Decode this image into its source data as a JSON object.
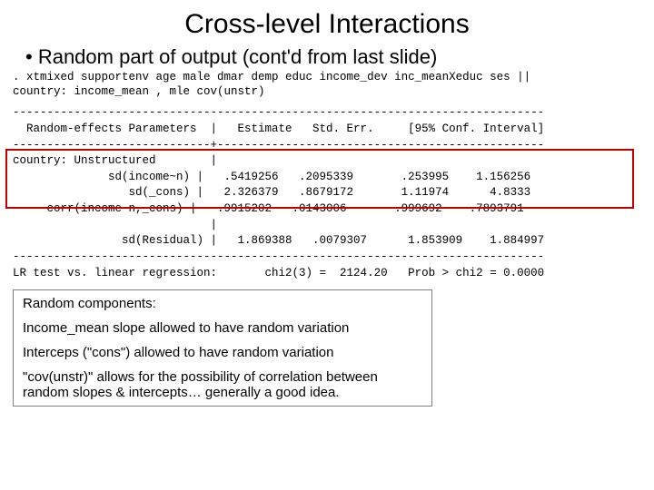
{
  "title": "Cross-level Interactions",
  "bullet": "Random part of output (cont'd from last slide)",
  "cmd": ". xtmixed supportenv age male dmar demp educ income_dev inc_meanXeduc ses ||\ncountry: income_mean , mle cov(unstr)",
  "table": {
    "hrule": "------------------------------------------------------------------------------",
    "hrule2": "-----------------------------+------------------------------------------------",
    "header": "  Random-effects Parameters  |   Estimate   Std. Err.     [95% Conf. Interval]",
    "rows": {
      "r0": "country: Unstructured        |",
      "r1": "              sd(income~n) |   .5419256   .2095339       .253995    1.156256",
      "r2": "                 sd(_cons) |   2.326379   .8679172       1.11974      4.8333",
      "r3": "     corr(income~n,_cons) |  -.9915202   .0143006      -.999692   -.7893791",
      "r4": "                             |",
      "r5": "                sd(Residual) |   1.869388   .0079307      1.853909    1.884997"
    },
    "lr": "LR test vs. linear regression:       chi2(3) =  2124.20   Prob > chi2 = 0.0000"
  },
  "box": {
    "heading": "Random components:",
    "p1": "Income_mean slope allowed to have random variation",
    "p2": "Interceps (\"cons\") allowed to have random variation",
    "p3": "\"cov(unstr)\" allows for the possibility of correlation between random slopes & intercepts… generally a good idea."
  },
  "chart_data": {
    "type": "table",
    "title": "Random-effects Parameters",
    "columns": [
      "Parameter",
      "Estimate",
      "Std. Err.",
      "95% CI Low",
      "95% CI High"
    ],
    "rows": [
      {
        "Parameter": "sd(income~n)",
        "Estimate": 0.5419256,
        "Std. Err.": 0.2095339,
        "95% CI Low": 0.253995,
        "95% CI High": 1.156256
      },
      {
        "Parameter": "sd(_cons)",
        "Estimate": 2.326379,
        "Std. Err.": 0.8679172,
        "95% CI Low": 1.11974,
        "95% CI High": 4.8333
      },
      {
        "Parameter": "corr(income~n,_cons)",
        "Estimate": -0.9915202,
        "Std. Err.": 0.0143006,
        "95% CI Low": -0.999692,
        "95% CI High": -0.7893791
      },
      {
        "Parameter": "sd(Residual)",
        "Estimate": 1.869388,
        "Std. Err.": 0.0079307,
        "95% CI Low": 1.853909,
        "95% CI High": 1.884997
      }
    ],
    "lr_test": {
      "chi2_df": 3,
      "chi2": 2124.2,
      "prob": 0.0
    }
  }
}
